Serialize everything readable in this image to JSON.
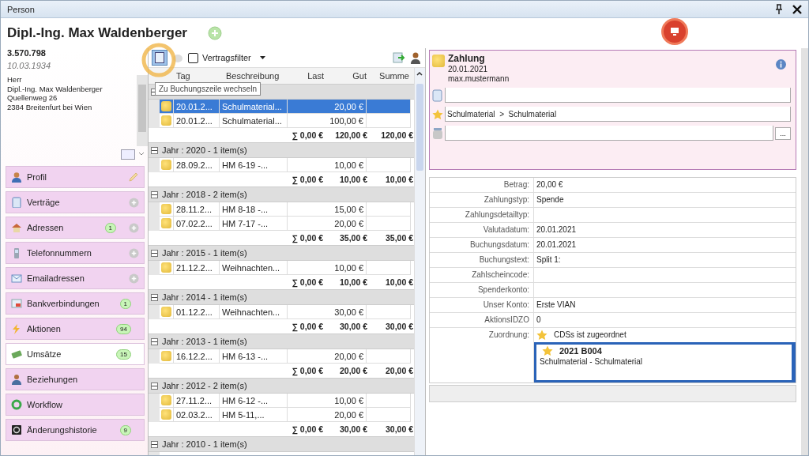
{
  "window": {
    "title": "Person"
  },
  "person": {
    "name": "Dipl.-Ing. Max Waldenberger",
    "number": "3.570.798",
    "birthdate": "10.03.1934",
    "address": [
      "Herr",
      "Dipl.-Ing. Max Waldenberger",
      "Quellenweg 26",
      "2384 Breitenfurt bei Wien"
    ]
  },
  "nav": [
    {
      "label": "Profil",
      "editable": true,
      "selected": false
    },
    {
      "label": "Verträge",
      "addable": true,
      "selected": false
    },
    {
      "label": "Adressen",
      "badge": "1",
      "addable": true,
      "selected": false
    },
    {
      "label": "Telefonnummern",
      "addable": true,
      "selected": false
    },
    {
      "label": "Emailadressen",
      "addable": true,
      "selected": false
    },
    {
      "label": "Bankverbindungen",
      "badge": "1",
      "selected": false
    },
    {
      "label": "Aktionen",
      "badge": "94",
      "selected": false
    },
    {
      "label": "Umsätze",
      "badge": "15",
      "selected": true
    },
    {
      "label": "Beziehungen",
      "selected": false
    },
    {
      "label": "Workflow",
      "selected": false
    },
    {
      "label": "Änderungshistorie",
      "badge": "9",
      "selected": false
    }
  ],
  "toolbar": {
    "filter_label": "Vertragsfilter",
    "filter_checked": false,
    "tooltip": "Zu Buchungszeile wechseln"
  },
  "table": {
    "columns": [
      "Tag",
      "Beschreibung",
      "Last",
      "Gut",
      "Summe"
    ],
    "groups": [
      {
        "rows": [
          {
            "date": "20.01.2...",
            "description": "Schulmaterial...",
            "amount": "20,00 €",
            "selected": true
          },
          {
            "date": "20.01.2...",
            "description": "Schulmaterial...",
            "amount": "100,00 €",
            "selected": false
          }
        ],
        "totals": [
          "∑ 0,00 €",
          "120,00 €",
          "120,00 €"
        ]
      },
      {
        "header": "Jahr : 2020 - 1 item(s)",
        "rows": [
          {
            "date": "28.09.2...",
            "description": "HM 6-19 -...",
            "amount": "10,00 €",
            "selected": false
          }
        ],
        "totals": [
          "∑ 0,00 €",
          "10,00 €",
          "10,00 €"
        ]
      },
      {
        "header": "Jahr : 2018 - 2 item(s)",
        "rows": [
          {
            "date": "28.11.2...",
            "description": "HM 8-18 -...",
            "amount": "15,00 €",
            "selected": false
          },
          {
            "date": "07.02.2...",
            "description": "HM 7-17 -...",
            "amount": "20,00 €",
            "selected": false
          }
        ],
        "totals": [
          "∑ 0,00 €",
          "35,00 €",
          "35,00 €"
        ]
      },
      {
        "header": "Jahr : 2015 - 1 item(s)",
        "rows": [
          {
            "date": "21.12.2...",
            "description": "Weihnachten...",
            "amount": "10,00 €",
            "selected": false
          }
        ],
        "totals": [
          "∑ 0,00 €",
          "10,00 €",
          "10,00 €"
        ]
      },
      {
        "header": "Jahr : 2014 - 1 item(s)",
        "rows": [
          {
            "date": "01.12.2...",
            "description": "Weihnachten...",
            "amount": "30,00 €",
            "selected": false
          }
        ],
        "totals": [
          "∑ 0,00 €",
          "30,00 €",
          "30,00 €"
        ]
      },
      {
        "header": "Jahr : 2013 - 1 item(s)",
        "rows": [
          {
            "date": "16.12.2...",
            "description": "HM 6-13 -...",
            "amount": "20,00 €",
            "selected": false
          }
        ],
        "totals": [
          "∑ 0,00 €",
          "20,00 €",
          "20,00 €"
        ]
      },
      {
        "header": "Jahr : 2012 - 2 item(s)",
        "rows": [
          {
            "date": "27.11.2...",
            "description": "HM 6-12 -...",
            "amount": "10,00 €",
            "selected": false
          },
          {
            "date": "02.03.2...",
            "description": "HM 5-11,...",
            "amount": "20,00 €",
            "selected": false
          }
        ],
        "totals": [
          "∑ 0,00 €",
          "30,00 €",
          "30,00 €"
        ]
      },
      {
        "header": "Jahr : 2010 - 1 item(s)"
      }
    ]
  },
  "payment": {
    "title": "Zahlung",
    "date": "20.01.2021",
    "user": "max.mustermann",
    "fields": [
      {
        "kind": "document"
      },
      {
        "kind": "category",
        "value": "Schulmaterial  >  Schulmaterial"
      },
      {
        "kind": "account",
        "button": "..."
      }
    ]
  },
  "details": [
    {
      "label": "Betrag:",
      "value": "20,00 €"
    },
    {
      "label": "Zahlungstyp:",
      "value": "Spende"
    },
    {
      "label": "Zahlungsdetailtyp:"
    },
    {
      "label": "Valutadatum:",
      "value": "20.01.2021"
    },
    {
      "label": "Buchungsdatum:",
      "value": "20.01.2021"
    },
    {
      "label": "Buchungstext:",
      "value": "Split 1:"
    },
    {
      "label": "Zahlscheincode:"
    },
    {
      "label": "Spenderkonto:"
    },
    {
      "label": "Unser Konto:",
      "value": "Erste VIAN"
    },
    {
      "label": "AktionsIDZO",
      "value": "0"
    }
  ],
  "assignment": {
    "label": "Zuordnung:",
    "status": "CDSs ist zugeordnet",
    "code": "2021 B004",
    "text": "Schulmaterial - Schulmaterial"
  }
}
